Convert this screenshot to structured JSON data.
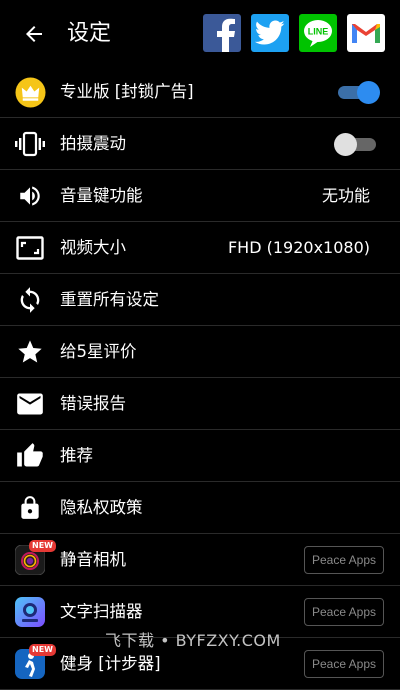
{
  "header": {
    "title": "设定",
    "back_icon": "arrow-back-icon",
    "share": [
      {
        "name": "facebook",
        "glyph": "f",
        "color": "#3b5998"
      },
      {
        "name": "twitter",
        "glyph": "",
        "color": "#1da1f2"
      },
      {
        "name": "line",
        "glyph": "LINE",
        "color": "#00c300"
      },
      {
        "name": "gmail",
        "glyph": "M",
        "color": "#ea4335"
      }
    ]
  },
  "settings": [
    {
      "icon": "crown-icon",
      "label": "专业版 [封锁广告]",
      "toggle": true
    },
    {
      "icon": "vibrate-icon",
      "label": "拍摄震动",
      "toggle": false
    },
    {
      "icon": "volume-icon",
      "label": "音量键功能",
      "value": "无功能"
    },
    {
      "icon": "aspect-ratio-icon",
      "label": "视频大小",
      "value": "FHD (1920x1080)"
    },
    {
      "icon": "reset-icon",
      "label": "重置所有设定"
    },
    {
      "icon": "star-icon",
      "label": "给5星评价"
    },
    {
      "icon": "mail-icon",
      "label": "错误报告"
    },
    {
      "icon": "thumb-up-icon",
      "label": "推荐"
    },
    {
      "icon": "lock-icon",
      "label": "隐私权政策"
    }
  ],
  "apps": [
    {
      "icon": "silent-camera-app-icon",
      "label": "静音相机",
      "badge": "NEW",
      "button": "Peace Apps"
    },
    {
      "icon": "text-scanner-app-icon",
      "label": "文字扫描器",
      "badge": "",
      "button": "Peace Apps"
    },
    {
      "icon": "fitness-app-icon",
      "label": "健身 [计步器]",
      "badge": "NEW",
      "button": "Peace Apps"
    }
  ],
  "watermark": "飞下载 • BYFZXY.COM"
}
